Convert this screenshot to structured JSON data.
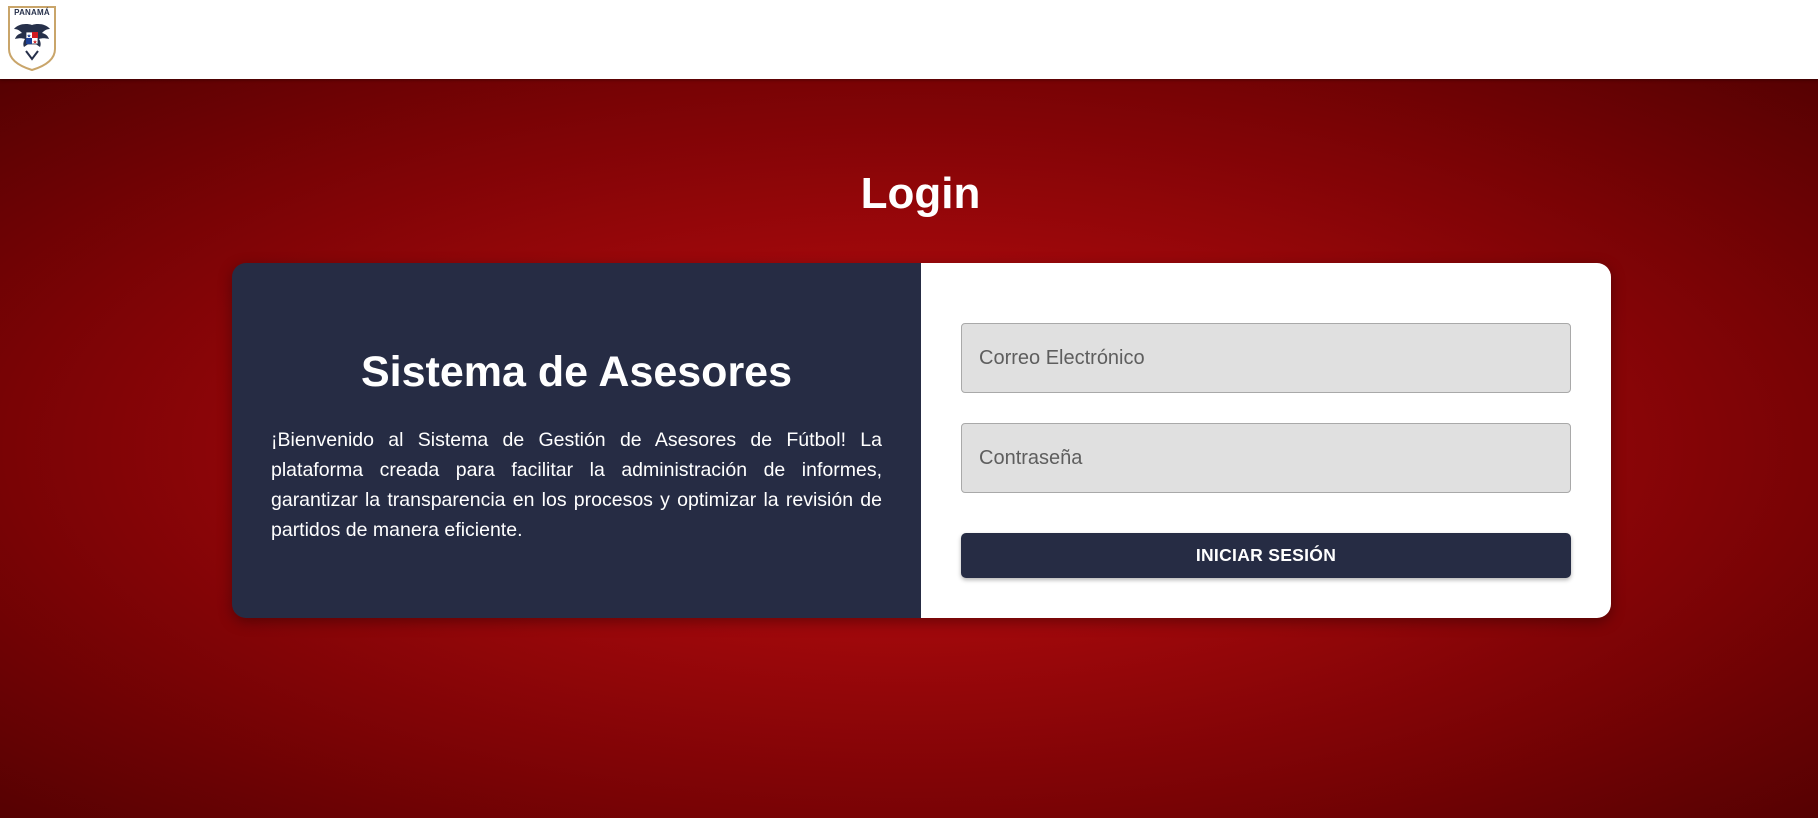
{
  "header": {
    "logo": {
      "text": "PANAMÁ",
      "icon": "panama-football-crest-icon"
    }
  },
  "login": {
    "title": "Login",
    "info": {
      "heading": "Sistema de Asesores",
      "description": "¡Bienvenido al Sistema de Gestión de Asesores de Fútbol! La plataforma creada para facilitar la administración de informes, garantizar la transparencia en los procesos y optimizar la revisión de partidos de manera eficiente."
    },
    "form": {
      "email_placeholder": "Correo Electrónico",
      "password_placeholder": "Contraseña",
      "submit_label": "INICIAR SESIÓN"
    }
  },
  "colors": {
    "primary_navy": "#262c44",
    "background_red": "#b30b0e",
    "field_bg": "#e0e0e0",
    "white": "#ffffff"
  }
}
